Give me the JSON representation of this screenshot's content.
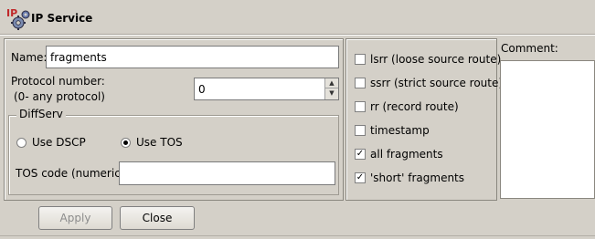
{
  "header": {
    "title": "IP Service",
    "icon": "ip-service-gear-icon",
    "icon_text": "IP"
  },
  "form": {
    "name_label": "Name:",
    "name_value": "fragments",
    "protocol_label_line1": "Protocol number:",
    "protocol_label_line2": "(0- any protocol)",
    "protocol_value": "0",
    "spinner_up": "▲",
    "spinner_down": "▼",
    "diffserv": {
      "legend": "DiffServ",
      "option_dscp": "Use DSCP",
      "option_tos": "Use TOS",
      "selected": "Use TOS",
      "tos_code_label": "TOS code (numeric):",
      "tos_code_value": ""
    }
  },
  "options": [
    {
      "label": "lsrr (loose source route)",
      "checked": false
    },
    {
      "label": "ssrr (strict source route)",
      "checked": false
    },
    {
      "label": "rr (record route)",
      "checked": false
    },
    {
      "label": "timestamp",
      "checked": false
    },
    {
      "label": "all fragments",
      "checked": true
    },
    {
      "label": "'short' fragments",
      "checked": true
    }
  ],
  "comment": {
    "label": "Comment:",
    "value": ""
  },
  "buttons": {
    "apply": "Apply",
    "apply_enabled": false,
    "close": "Close"
  },
  "colors": {
    "background": "#d4d0c8",
    "field": "#ffffff",
    "disabled_text": "#8c8c8c"
  }
}
